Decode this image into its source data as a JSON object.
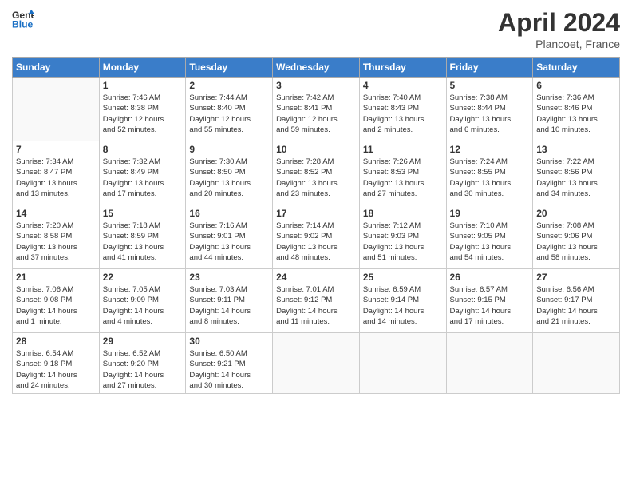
{
  "header": {
    "logo_line1": "General",
    "logo_line2": "Blue",
    "month": "April 2024",
    "location": "Plancoet, France"
  },
  "weekdays": [
    "Sunday",
    "Monday",
    "Tuesday",
    "Wednesday",
    "Thursday",
    "Friday",
    "Saturday"
  ],
  "weeks": [
    [
      {
        "day": "",
        "info": ""
      },
      {
        "day": "1",
        "info": "Sunrise: 7:46 AM\nSunset: 8:38 PM\nDaylight: 12 hours\nand 52 minutes."
      },
      {
        "day": "2",
        "info": "Sunrise: 7:44 AM\nSunset: 8:40 PM\nDaylight: 12 hours\nand 55 minutes."
      },
      {
        "day": "3",
        "info": "Sunrise: 7:42 AM\nSunset: 8:41 PM\nDaylight: 12 hours\nand 59 minutes."
      },
      {
        "day": "4",
        "info": "Sunrise: 7:40 AM\nSunset: 8:43 PM\nDaylight: 13 hours\nand 2 minutes."
      },
      {
        "day": "5",
        "info": "Sunrise: 7:38 AM\nSunset: 8:44 PM\nDaylight: 13 hours\nand 6 minutes."
      },
      {
        "day": "6",
        "info": "Sunrise: 7:36 AM\nSunset: 8:46 PM\nDaylight: 13 hours\nand 10 minutes."
      }
    ],
    [
      {
        "day": "7",
        "info": "Sunrise: 7:34 AM\nSunset: 8:47 PM\nDaylight: 13 hours\nand 13 minutes."
      },
      {
        "day": "8",
        "info": "Sunrise: 7:32 AM\nSunset: 8:49 PM\nDaylight: 13 hours\nand 17 minutes."
      },
      {
        "day": "9",
        "info": "Sunrise: 7:30 AM\nSunset: 8:50 PM\nDaylight: 13 hours\nand 20 minutes."
      },
      {
        "day": "10",
        "info": "Sunrise: 7:28 AM\nSunset: 8:52 PM\nDaylight: 13 hours\nand 23 minutes."
      },
      {
        "day": "11",
        "info": "Sunrise: 7:26 AM\nSunset: 8:53 PM\nDaylight: 13 hours\nand 27 minutes."
      },
      {
        "day": "12",
        "info": "Sunrise: 7:24 AM\nSunset: 8:55 PM\nDaylight: 13 hours\nand 30 minutes."
      },
      {
        "day": "13",
        "info": "Sunrise: 7:22 AM\nSunset: 8:56 PM\nDaylight: 13 hours\nand 34 minutes."
      }
    ],
    [
      {
        "day": "14",
        "info": "Sunrise: 7:20 AM\nSunset: 8:58 PM\nDaylight: 13 hours\nand 37 minutes."
      },
      {
        "day": "15",
        "info": "Sunrise: 7:18 AM\nSunset: 8:59 PM\nDaylight: 13 hours\nand 41 minutes."
      },
      {
        "day": "16",
        "info": "Sunrise: 7:16 AM\nSunset: 9:01 PM\nDaylight: 13 hours\nand 44 minutes."
      },
      {
        "day": "17",
        "info": "Sunrise: 7:14 AM\nSunset: 9:02 PM\nDaylight: 13 hours\nand 48 minutes."
      },
      {
        "day": "18",
        "info": "Sunrise: 7:12 AM\nSunset: 9:03 PM\nDaylight: 13 hours\nand 51 minutes."
      },
      {
        "day": "19",
        "info": "Sunrise: 7:10 AM\nSunset: 9:05 PM\nDaylight: 13 hours\nand 54 minutes."
      },
      {
        "day": "20",
        "info": "Sunrise: 7:08 AM\nSunset: 9:06 PM\nDaylight: 13 hours\nand 58 minutes."
      }
    ],
    [
      {
        "day": "21",
        "info": "Sunrise: 7:06 AM\nSunset: 9:08 PM\nDaylight: 14 hours\nand 1 minute."
      },
      {
        "day": "22",
        "info": "Sunrise: 7:05 AM\nSunset: 9:09 PM\nDaylight: 14 hours\nand 4 minutes."
      },
      {
        "day": "23",
        "info": "Sunrise: 7:03 AM\nSunset: 9:11 PM\nDaylight: 14 hours\nand 8 minutes."
      },
      {
        "day": "24",
        "info": "Sunrise: 7:01 AM\nSunset: 9:12 PM\nDaylight: 14 hours\nand 11 minutes."
      },
      {
        "day": "25",
        "info": "Sunrise: 6:59 AM\nSunset: 9:14 PM\nDaylight: 14 hours\nand 14 minutes."
      },
      {
        "day": "26",
        "info": "Sunrise: 6:57 AM\nSunset: 9:15 PM\nDaylight: 14 hours\nand 17 minutes."
      },
      {
        "day": "27",
        "info": "Sunrise: 6:56 AM\nSunset: 9:17 PM\nDaylight: 14 hours\nand 21 minutes."
      }
    ],
    [
      {
        "day": "28",
        "info": "Sunrise: 6:54 AM\nSunset: 9:18 PM\nDaylight: 14 hours\nand 24 minutes."
      },
      {
        "day": "29",
        "info": "Sunrise: 6:52 AM\nSunset: 9:20 PM\nDaylight: 14 hours\nand 27 minutes."
      },
      {
        "day": "30",
        "info": "Sunrise: 6:50 AM\nSunset: 9:21 PM\nDaylight: 14 hours\nand 30 minutes."
      },
      {
        "day": "",
        "info": ""
      },
      {
        "day": "",
        "info": ""
      },
      {
        "day": "",
        "info": ""
      },
      {
        "day": "",
        "info": ""
      }
    ]
  ]
}
